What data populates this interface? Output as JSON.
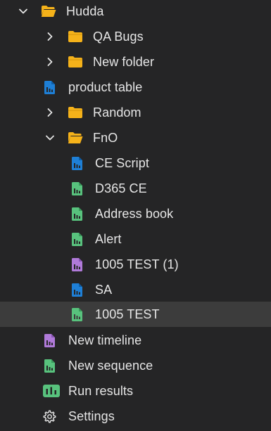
{
  "colors": {
    "background": "#252526",
    "selected_row": "#3c3c3c",
    "text": "#e6e6e6",
    "folder": "#f5b21a",
    "chart_blue": "#1e7fd6",
    "chart_green": "#58c27d",
    "chart_purple": "#b07ad9"
  },
  "tree": {
    "hudda": {
      "label": "Hudda",
      "state": "expanded",
      "icon": "folder-open-icon"
    },
    "qa_bugs": {
      "label": "QA Bugs",
      "state": "collapsed",
      "icon": "folder-icon"
    },
    "new_folder": {
      "label": "New folder",
      "state": "collapsed",
      "icon": "folder-icon"
    },
    "product_table": {
      "label": "product table",
      "icon": "chart-file-icon",
      "icon_color": "blue"
    },
    "random": {
      "label": "Random",
      "state": "collapsed",
      "icon": "folder-icon"
    },
    "fno": {
      "label": "FnO",
      "state": "expanded",
      "icon": "folder-open-icon"
    },
    "ce_script": {
      "label": "CE Script",
      "icon": "chart-file-icon",
      "icon_color": "blue"
    },
    "d365_ce": {
      "label": "D365 CE",
      "icon": "chart-file-icon",
      "icon_color": "green"
    },
    "address_book": {
      "label": "Address book",
      "icon": "chart-file-icon",
      "icon_color": "green"
    },
    "alert": {
      "label": "Alert",
      "icon": "chart-file-icon",
      "icon_color": "green"
    },
    "test_1005_copy": {
      "label": "1005 TEST (1)",
      "icon": "chart-file-icon",
      "icon_color": "purple"
    },
    "sa": {
      "label": "SA",
      "icon": "chart-file-icon",
      "icon_color": "blue"
    },
    "test_1005": {
      "label": "1005 TEST",
      "icon": "chart-file-icon",
      "icon_color": "green",
      "selected": true
    }
  },
  "actions": {
    "new_timeline": {
      "label": "New timeline",
      "icon": "new-timeline-icon"
    },
    "new_sequence": {
      "label": "New sequence",
      "icon": "new-sequence-icon"
    },
    "run_results": {
      "label": "Run results",
      "icon": "bar-chart-icon"
    },
    "settings": {
      "label": "Settings",
      "icon": "gear-icon"
    }
  }
}
